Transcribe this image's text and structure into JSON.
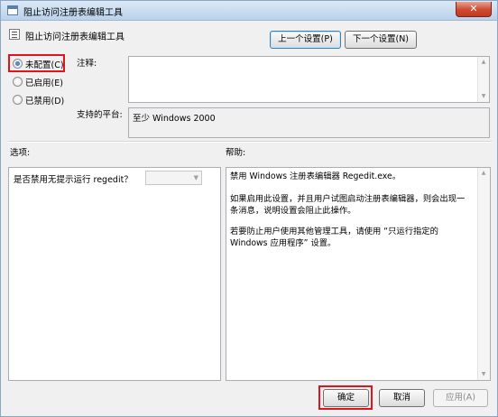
{
  "window": {
    "title": "阻止访问注册表编辑工具",
    "close_glyph": "✕"
  },
  "header": {
    "policy_title": "阻止访问注册表编辑工具",
    "prev_button": "上一个设置(P)",
    "next_button": "下一个设置(N)"
  },
  "state": {
    "options": [
      {
        "label": "未配置(C)",
        "checked": true
      },
      {
        "label": "已启用(E)",
        "checked": false
      },
      {
        "label": "已禁用(D)",
        "checked": false
      }
    ]
  },
  "comment": {
    "label": "注释:",
    "value": ""
  },
  "platform": {
    "label": "支持的平台:",
    "value": "至少 Windows 2000"
  },
  "options_section": {
    "label": "选项:",
    "item_label": "是否禁用无提示运行 regedit？",
    "item_value": ""
  },
  "help_section": {
    "label": "帮助:",
    "paragraphs": [
      "禁用 Windows 注册表编辑器 Regedit.exe。",
      "如果启用此设置，并且用户试图启动注册表编辑器，则会出现一条消息，说明设置会阻止此操作。",
      "若要防止用户使用其他管理工具，请使用 “只运行指定的 Windows 应用程序” 设置。"
    ]
  },
  "footer": {
    "ok_button": "确定",
    "cancel_button": "取消",
    "apply_button": "应用(A)"
  },
  "icons": {
    "scroll_up": "▲",
    "scroll_down": "▼",
    "dropdown": "▼"
  },
  "colors": {
    "highlight": "#e0141e",
    "title_bar": "#c7dbef",
    "close_button": "#cf4a31"
  }
}
